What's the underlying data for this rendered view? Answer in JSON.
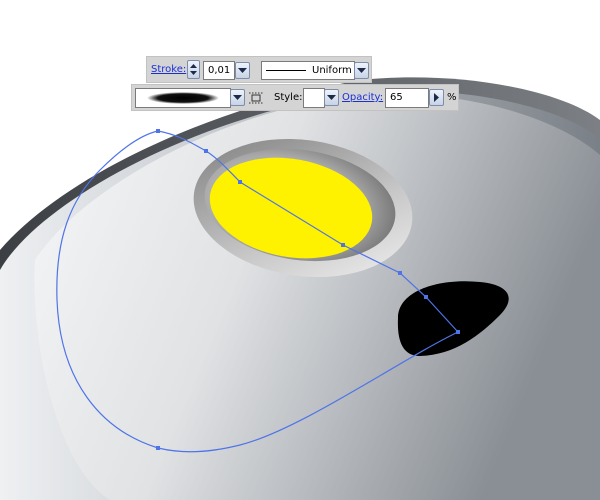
{
  "stroke_toolbar": {
    "stroke_label": "Stroke:",
    "stroke_value": "0,01 pt",
    "profile_label": "Uniform"
  },
  "brush_toolbar": {
    "style_label": "Style:",
    "opacity_label": "Opacity:",
    "opacity_value": "65",
    "percent_sign": "%"
  },
  "colors": {
    "selection_path": "#4f74e8",
    "link_label": "#1a2fd6",
    "yellow_button": "#fff200",
    "black_button": "#000000"
  }
}
